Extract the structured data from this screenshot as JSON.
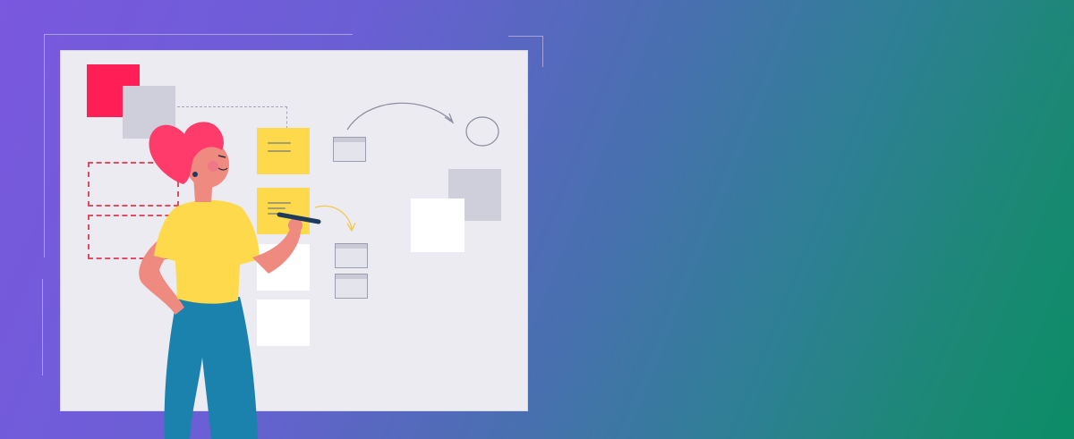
{
  "illustration": {
    "subject": "woman-writing-on-whiteboard",
    "colors": {
      "background_start": "#7a58df",
      "background_end": "#0b8d66",
      "board": "#ebebf1",
      "sticky_yellow": "#fdd94b",
      "accent_red": "#ff1e55",
      "accent_grey": "#cfcfdb",
      "hair": "#ff3b6b",
      "shirt": "#fdd94b",
      "pants": "#1b82ad",
      "skin": "#ef8a80"
    },
    "icons": [
      "pen-icon",
      "arrow-icon",
      "circle-shape"
    ]
  }
}
